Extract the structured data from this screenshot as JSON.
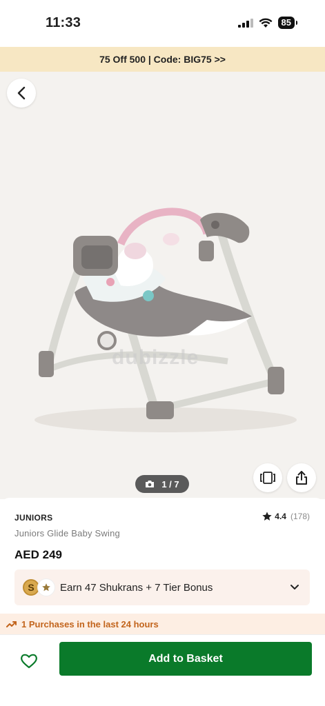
{
  "status_bar": {
    "time": "11:33",
    "battery": "85"
  },
  "promo": {
    "text": "75 Off 500 | Code: BIG75 >>"
  },
  "gallery": {
    "watermark": "dubizzle",
    "counter": "1 / 7"
  },
  "product": {
    "brand": "JUNIORS",
    "rating": "4.4",
    "rating_count": "(178)",
    "name": "Juniors Glide Baby Swing",
    "price": "AED 249"
  },
  "shukran": {
    "text": "Earn 47 Shukrans + 7 Tier Bonus",
    "coin_letter": "S"
  },
  "purchases": {
    "text": "1 Purchases in the last 24 hours"
  },
  "actions": {
    "add_to_basket": "Add to Basket"
  },
  "colors": {
    "primary_green": "#0a7a2a",
    "promo_bg": "#f7e7c3",
    "trend_orange": "#c2641c"
  }
}
